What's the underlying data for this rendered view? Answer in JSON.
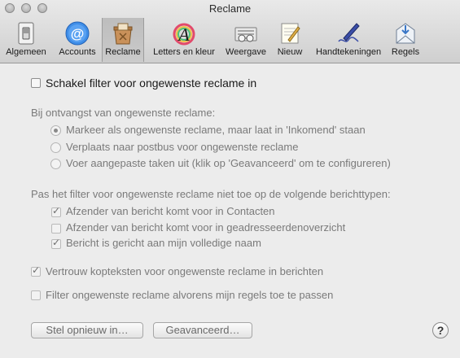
{
  "window": {
    "title": "Reclame"
  },
  "toolbar": {
    "items": [
      {
        "label": "Algemeen"
      },
      {
        "label": "Accounts"
      },
      {
        "label": "Reclame"
      },
      {
        "label": "Letters en kleur"
      },
      {
        "label": "Weergave"
      },
      {
        "label": "Nieuw"
      },
      {
        "label": "Handtekeningen"
      },
      {
        "label": "Regels"
      }
    ],
    "selected": "Reclame"
  },
  "filter": {
    "enable_label": "Schakel filter voor ongewenste reclame in",
    "enabled": false
  },
  "on_receive": {
    "heading": "Bij ontvangst van ongewenste reclame:",
    "options": [
      {
        "label": "Markeer als ongewenste reclame, maar laat in 'Inkomend' staan",
        "selected": true
      },
      {
        "label": "Verplaats naar postbus voor ongewenste reclame",
        "selected": false
      },
      {
        "label": "Voer aangepaste taken uit (klik op 'Geavanceerd' om te configureren)",
        "selected": false
      }
    ]
  },
  "exemptions": {
    "heading": "Pas het filter voor ongewenste reclame niet toe op de volgende berichttypen:",
    "items": [
      {
        "label": "Afzender van bericht komt voor in Contacten",
        "checked": true
      },
      {
        "label": "Afzender van bericht komt voor in geadresseerdenoverzicht",
        "checked": false
      },
      {
        "label": "Bericht is gericht aan mijn volledige naam",
        "checked": true
      }
    ]
  },
  "headers": {
    "trust_label": "Vertrouw kopteksten voor ongewenste reclame in berichten",
    "trust_checked": true,
    "before_rules_label": "Filter ongewenste reclame alvorens mijn regels toe te passen",
    "before_rules_checked": false
  },
  "buttons": {
    "reset_label": "Stel opnieuw in…",
    "advanced_label": "Geavanceerd…",
    "help_label": "?"
  }
}
